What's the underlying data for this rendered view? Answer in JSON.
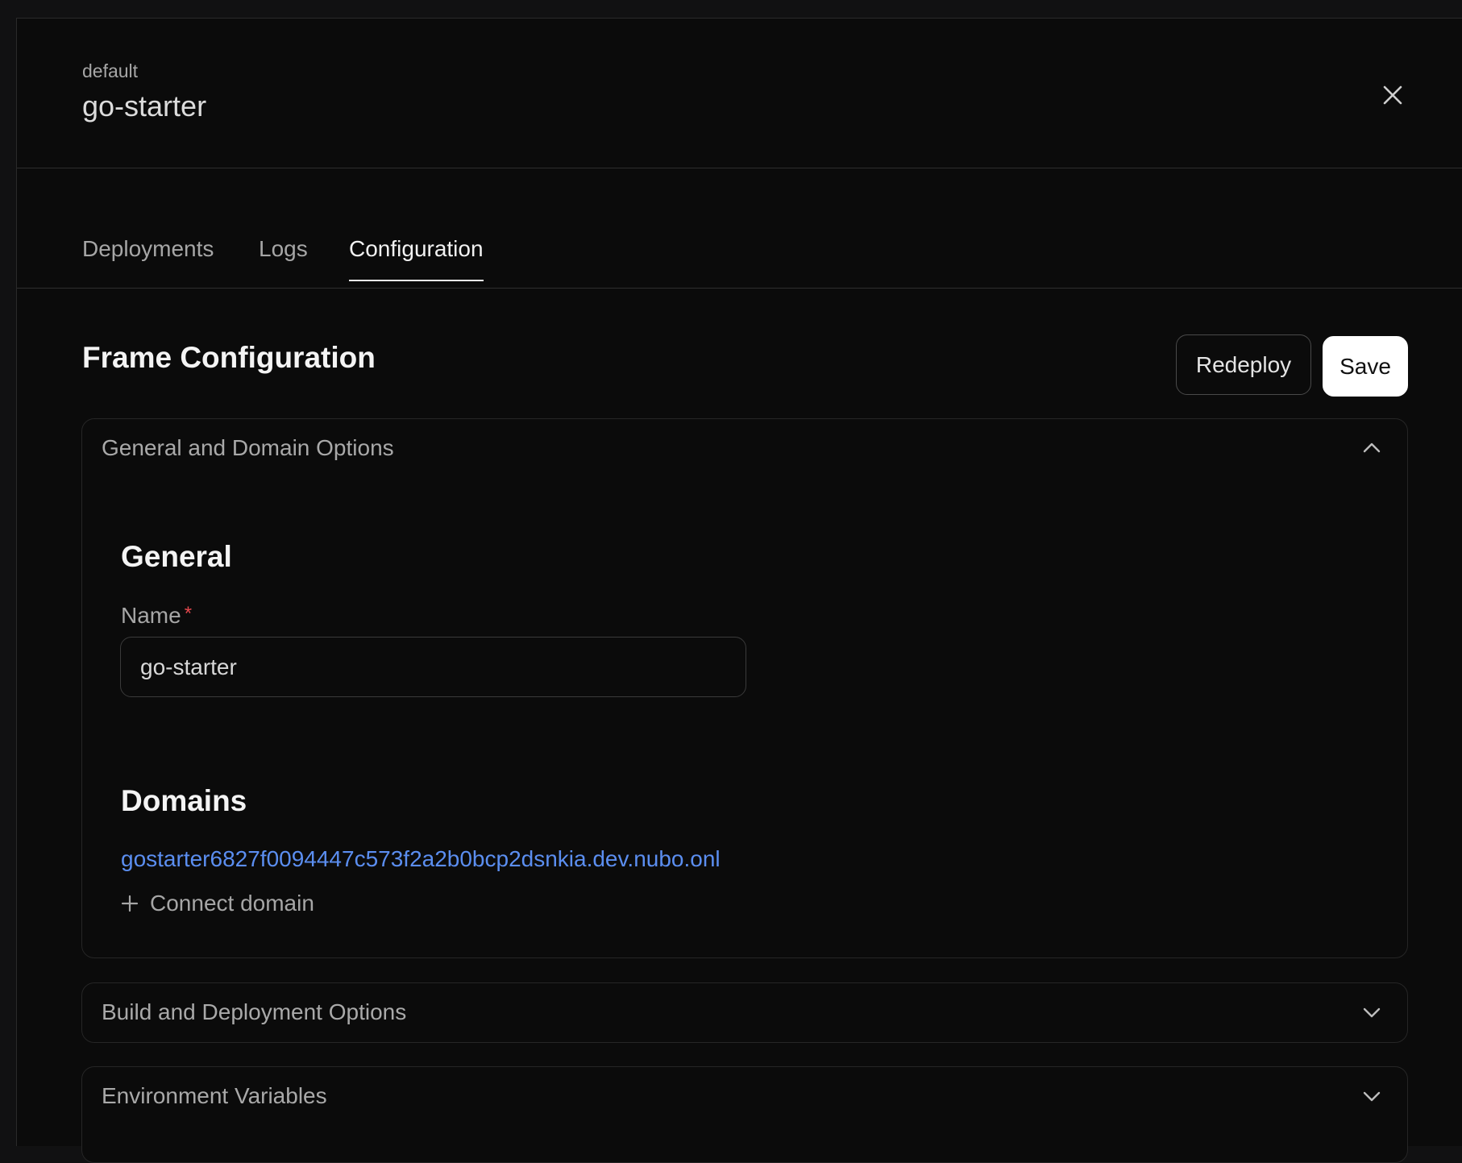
{
  "header": {
    "project": "default",
    "title": "go-starter"
  },
  "tabs": [
    {
      "label": "Deployments",
      "active": false
    },
    {
      "label": "Logs",
      "active": false
    },
    {
      "label": "Configuration",
      "active": true
    }
  ],
  "main": {
    "title": "Frame Configuration",
    "redeploy_label": "Redeploy",
    "save_label": "Save"
  },
  "sections": {
    "general_domain": {
      "label": "General and Domain Options",
      "expanded": true,
      "general": {
        "title": "General",
        "name_label": "Name",
        "required_mark": "*",
        "name_value": "go-starter"
      },
      "domains": {
        "title": "Domains",
        "domain": "gostarter6827f0094447c573f2a2b0bcp2dsnkia.dev.nubo.onl",
        "connect_label": "Connect domain"
      }
    },
    "build": {
      "label": "Build and Deployment Options",
      "expanded": false
    },
    "env": {
      "label": "Environment Variables",
      "expanded": false
    }
  },
  "icons": {
    "close": "close-icon",
    "chevron_up": "chevron-up-icon",
    "chevron_down": "chevron-down-icon",
    "plus": "plus-icon"
  },
  "colors": {
    "background": "#0b0b0b",
    "link": "#5b8ef0",
    "required": "#e5484d"
  }
}
